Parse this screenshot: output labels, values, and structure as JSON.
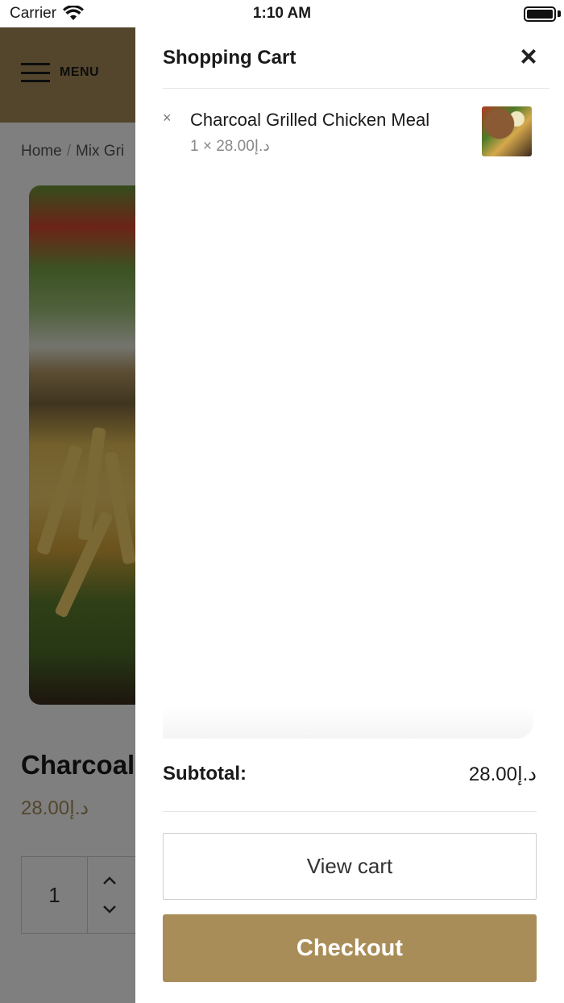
{
  "status_bar": {
    "carrier": "Carrier",
    "time": "1:10 AM",
    "wifi_icon": "wifi-icon",
    "battery_level": 1.0
  },
  "header": {
    "menu_label": "MENU",
    "menu_icon": "hamburger-icon",
    "accent_color": "#a98d58"
  },
  "breadcrumb": {
    "home": "Home",
    "separator": "/",
    "category": "Mix Gri"
  },
  "product": {
    "title": "Charcoal",
    "price": "28.00د.إ",
    "quantity": "1"
  },
  "cart": {
    "title": "Shopping Cart",
    "close_icon": "close-icon",
    "items": [
      {
        "remove": "×",
        "name": "Charcoal Grilled Chicken Meal",
        "qty_price": "1 × 28.00د.إ"
      }
    ],
    "subtotal_label": "Subtotal:",
    "subtotal_value": "28.00د.إ",
    "view_cart_label": "View cart",
    "checkout_label": "Checkout",
    "checkout_color": "#a98d58"
  }
}
